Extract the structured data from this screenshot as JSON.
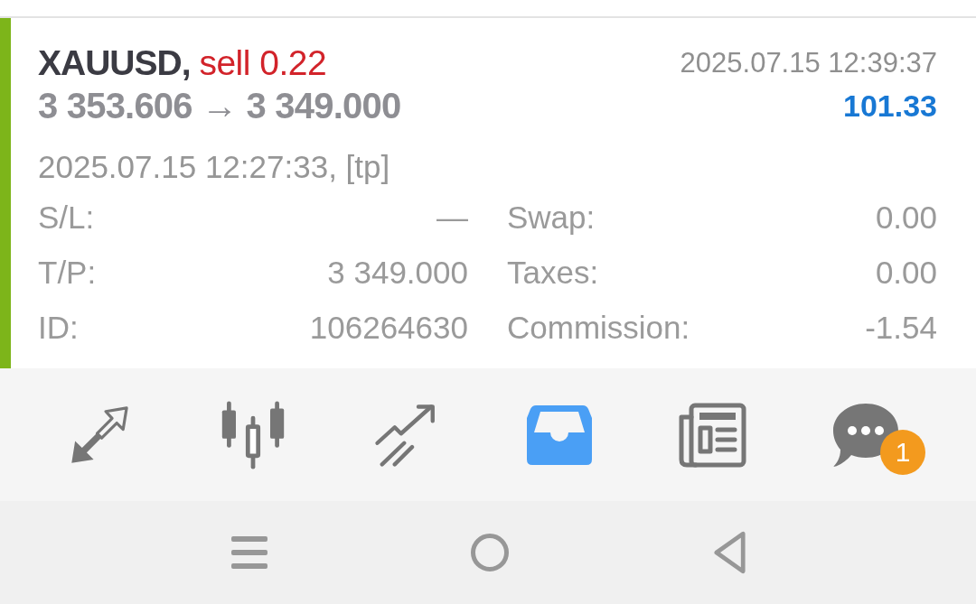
{
  "position": {
    "symbol": "XAUUSD,",
    "order": "sell 0.22",
    "close_time": "2025.07.15 12:39:37",
    "price_change": "3 353.606 → 3 349.000",
    "profit": "101.33",
    "open_info": "2025.07.15 12:27:33, [tp]",
    "details": [
      {
        "label": "S/L:",
        "value": "—"
      },
      {
        "label": "Swap:",
        "value": "0.00"
      },
      {
        "label": "T/P:",
        "value": "3 349.000"
      },
      {
        "label": "Taxes:",
        "value": "0.00"
      },
      {
        "label": "ID:",
        "value": "106264630"
      },
      {
        "label": "Commission:",
        "value": "-1.54"
      }
    ]
  },
  "tab_bar": [
    {
      "kind": "arrows",
      "selected": false
    },
    {
      "kind": "candles",
      "selected": false
    },
    {
      "kind": "trend",
      "selected": false
    },
    {
      "kind": "tray",
      "selected": true
    },
    {
      "kind": "newspaper",
      "selected": false
    },
    {
      "kind": "chat",
      "selected": false,
      "badge": "1"
    }
  ],
  "nav_bar": [
    {
      "kind": "menu"
    },
    {
      "kind": "home"
    },
    {
      "kind": "back"
    }
  ]
}
